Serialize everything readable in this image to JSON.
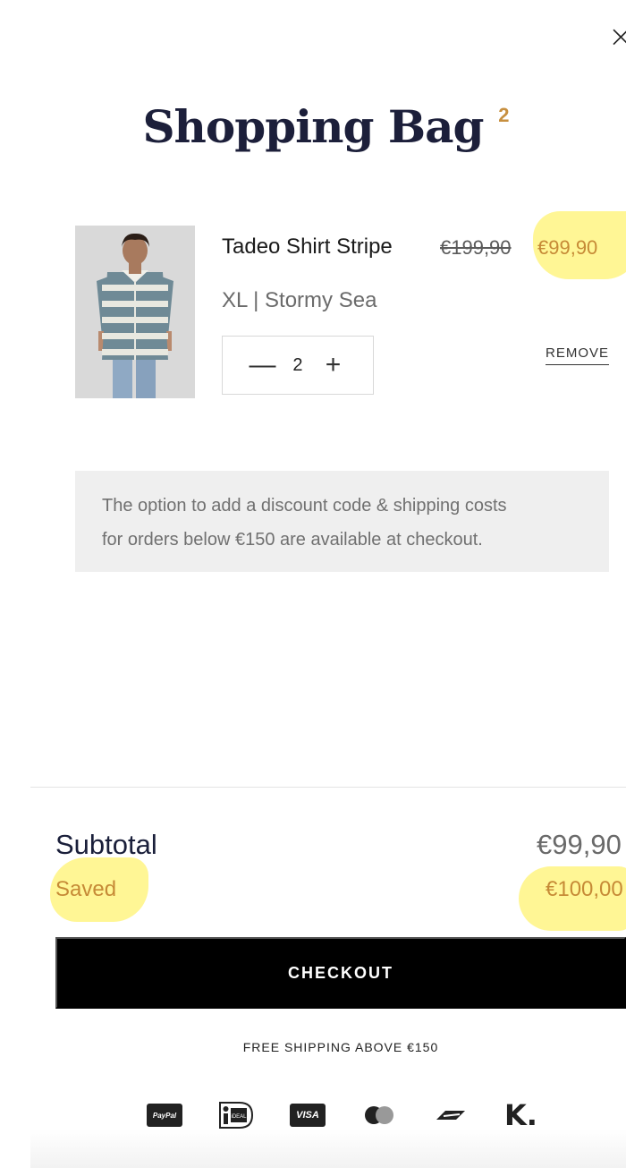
{
  "header": {
    "close_glyph": "×",
    "title": "Shopping Bag",
    "item_count": "2"
  },
  "cart": {
    "items": [
      {
        "name": "Tadeo Shirt Stripe",
        "original_price": "€199,90",
        "sale_price": "€99,90",
        "variant": "XL | Stormy Sea",
        "quantity": "2",
        "decrease_glyph": "—",
        "increase_glyph": "+",
        "remove_label": "REMOVE",
        "image_icon": "product-photo-striped-shirt"
      }
    ]
  },
  "notice": {
    "line1": "The option to add a discount code & shipping costs",
    "line2": "for orders below €150 are available at checkout."
  },
  "summary": {
    "subtotal_label": "Subtotal",
    "subtotal_value": "€99,90",
    "saved_label": "Saved",
    "saved_value": "€100,00"
  },
  "checkout": {
    "button_label": "CHECKOUT",
    "free_shipping_text": "FREE SHIPPING ABOVE €150"
  },
  "payment_methods": {
    "paypal": "PayPal",
    "ideal": "iDEAL",
    "visa": "VISA",
    "klarna": "K."
  },
  "colors": {
    "accent": "#c68a36",
    "highlight": "#fff58a",
    "title": "#1c1f3a",
    "button_bg": "#000000"
  }
}
